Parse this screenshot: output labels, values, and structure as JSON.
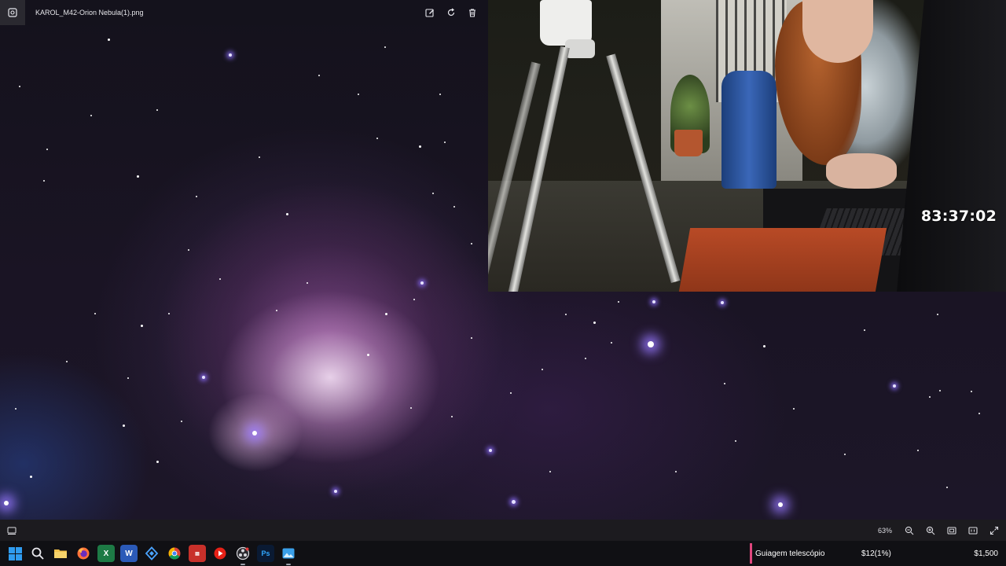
{
  "window": {
    "file_title": "KAROL_M42-Orion Nebula(1).png",
    "icons": [
      "photos-app-icon",
      "edit-image-icon",
      "rotate-icon",
      "delete-icon"
    ]
  },
  "stream_overlay": {
    "timer": "83:37:02"
  },
  "viewer_toolbar": {
    "zoom": "63%",
    "icons": [
      "filmstrip-icon",
      "zoom-out-icon",
      "zoom-in-icon",
      "fit-to-window-icon",
      "actual-size-icon",
      "fullscreen-icon"
    ]
  },
  "taskbar": {
    "apps": [
      "start",
      "search",
      "file-explorer",
      "firefox",
      "excel",
      "word",
      "app-diamond",
      "chrome",
      "app-tile",
      "youtube-music",
      "obs",
      "photoshop",
      "photos"
    ]
  },
  "goal_widget": {
    "label": "Guiagem telescópio",
    "progress": "$12(1%)",
    "target": "$1,500",
    "fraction": 0.01,
    "accent_color": "#e0477e"
  }
}
